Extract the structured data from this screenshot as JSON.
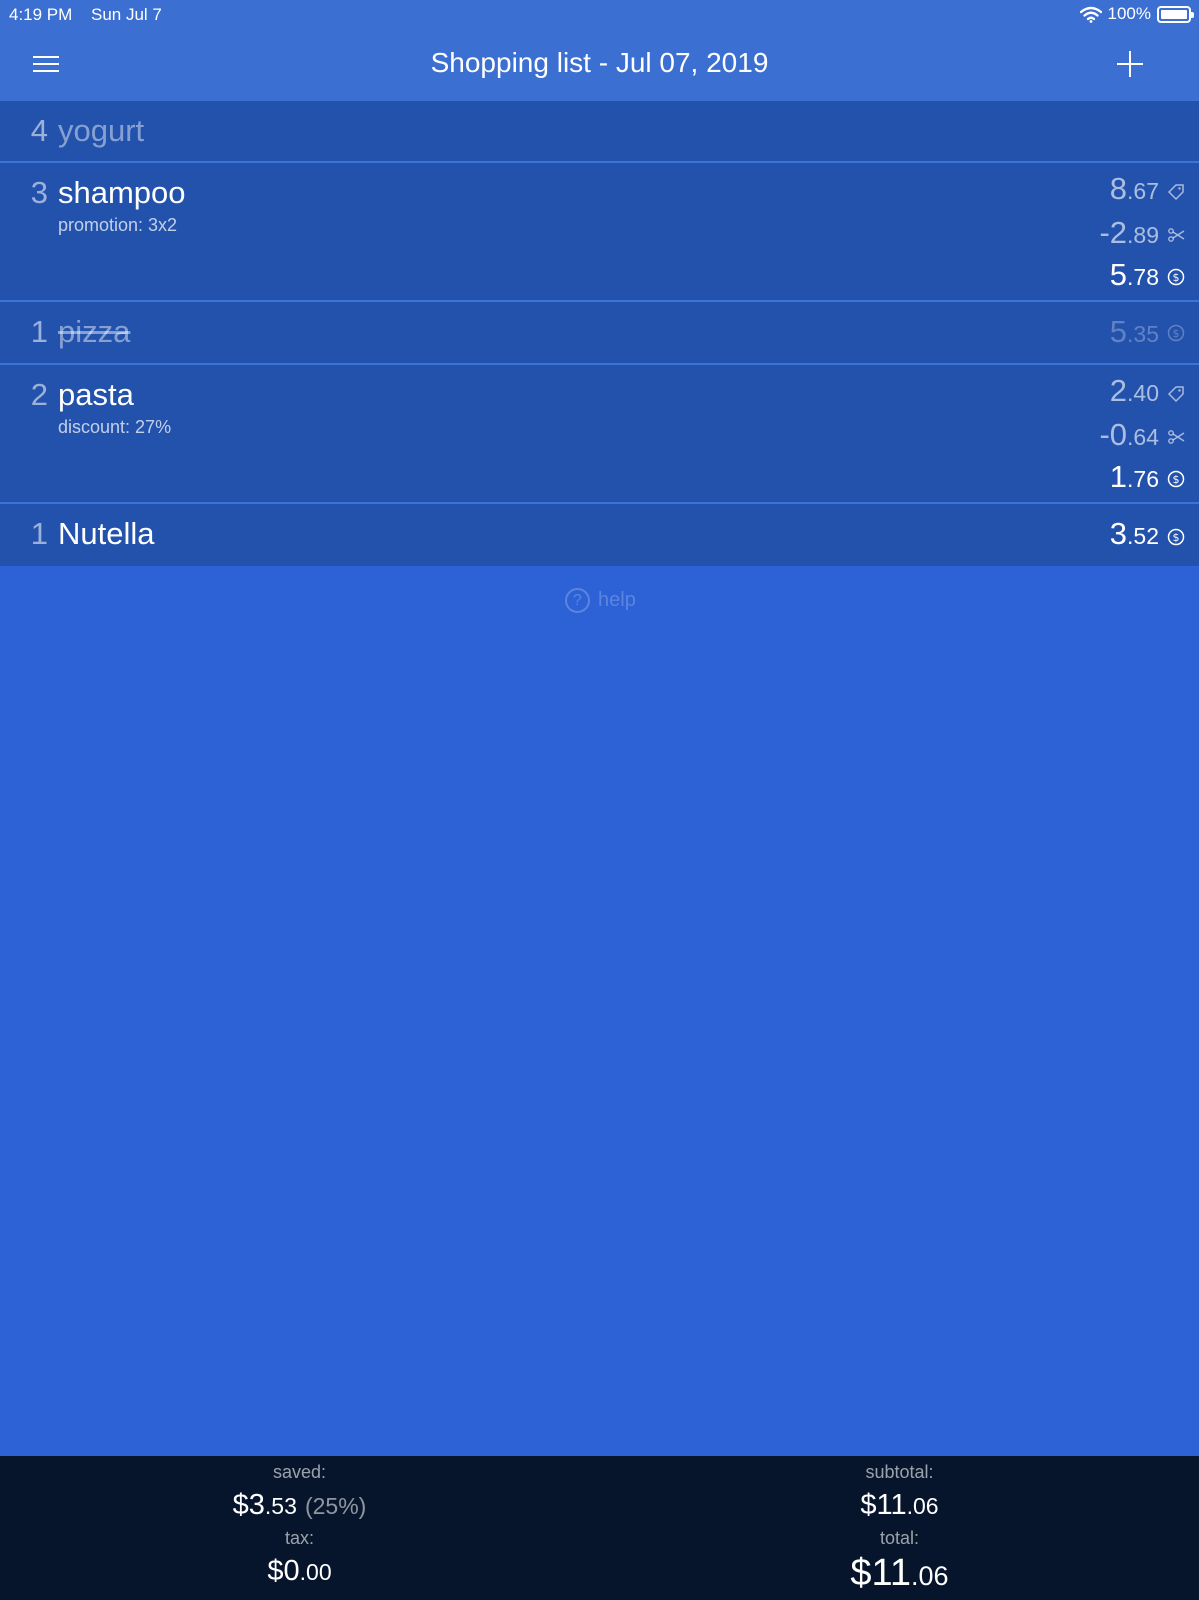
{
  "status_bar": {
    "time": "4:19 PM",
    "date": "Sun Jul 7",
    "battery": "100%"
  },
  "nav": {
    "title": "Shopping list - Jul 07, 2019"
  },
  "items": [
    {
      "qty": "4",
      "name": "yogurt",
      "done": false
    },
    {
      "qty": "3",
      "name": "shampoo",
      "note": "promotion: 3x2",
      "price_int": "8",
      "price_cents": ".67",
      "saving_int": "-2",
      "saving_cents": ".89",
      "total_int": "5",
      "total_cents": ".78"
    },
    {
      "qty": "1",
      "name": "pizza",
      "done": true,
      "total_int": "5",
      "total_cents": ".35"
    },
    {
      "qty": "2",
      "name": "pasta",
      "note": "discount: 27%",
      "price_int": "2",
      "price_cents": ".40",
      "saving_int": "-0",
      "saving_cents": ".64",
      "total_int": "1",
      "total_cents": ".76"
    },
    {
      "qty": "1",
      "name": "Nutella",
      "total_int": "3",
      "total_cents": ".52"
    }
  ],
  "help_label": "help",
  "footer": {
    "saved_label": "saved:",
    "saved_int": "$3",
    "saved_cents": ".53",
    "saved_pct": "(25%)",
    "tax_label": "tax:",
    "tax_int": "$0",
    "tax_cents": ".00",
    "subtotal_label": "subtotal:",
    "subtotal_int": "$11",
    "subtotal_cents": ".06",
    "total_label": "total:",
    "total_int": "$11",
    "total_cents": ".06"
  },
  "icons": {
    "menu": "hamburger-menu-icon",
    "add": "plus-icon",
    "price": "price-tag-icon",
    "saving": "scissors-icon",
    "total": "dollar-coin-icon",
    "help": "question-circle-icon",
    "wifi": "wifi-icon",
    "battery": "battery-icon"
  }
}
